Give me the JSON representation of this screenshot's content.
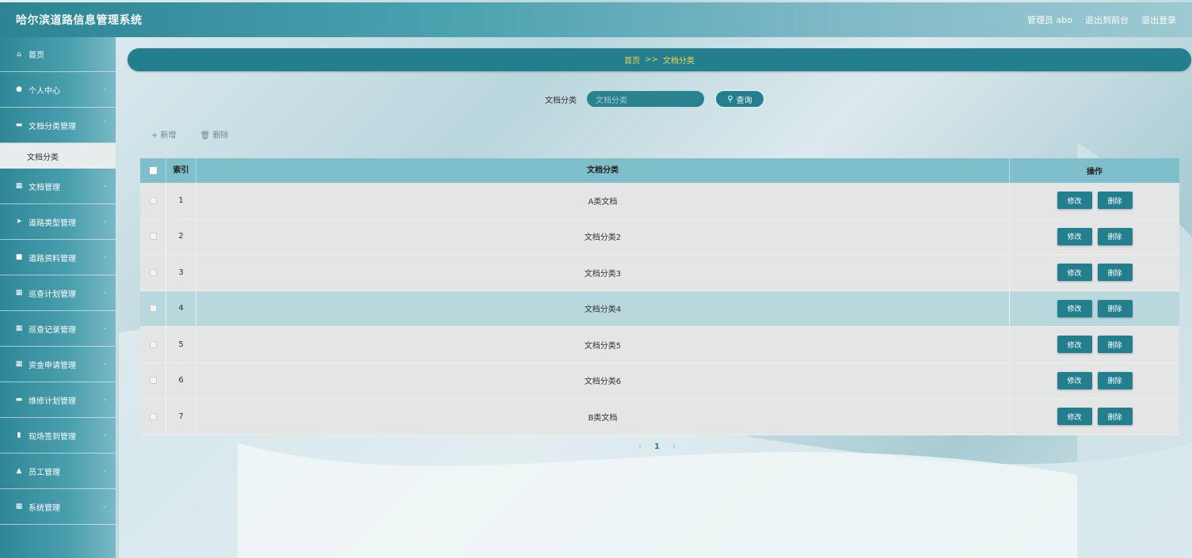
{
  "header": {
    "title": "哈尔滨道路信息管理系统",
    "user": "管理员 abo",
    "to_front": "退出到前台",
    "logout": "退出登录"
  },
  "sidebar": {
    "items": [
      {
        "label": "首页",
        "icon": "home-icon",
        "glyph": "⌂"
      },
      {
        "label": "个人中心",
        "icon": "user-icon",
        "glyph": "●"
      },
      {
        "label": "文档分类管理",
        "icon": "grid-icon",
        "glyph": "▬"
      },
      {
        "label": "文档分类",
        "icon": "",
        "glyph": ""
      },
      {
        "label": "文档管理",
        "icon": "grid-icon",
        "glyph": "▦"
      },
      {
        "label": "道路类型管理",
        "icon": "send-icon",
        "glyph": "➤"
      },
      {
        "label": "道路资料管理",
        "icon": "file-icon",
        "glyph": "■"
      },
      {
        "label": "巡查计划管理",
        "icon": "grid-icon",
        "glyph": "▦"
      },
      {
        "label": "巡查记录管理",
        "icon": "grid-icon",
        "glyph": "▦"
      },
      {
        "label": "资金申请管理",
        "icon": "grid-icon",
        "glyph": "▦"
      },
      {
        "label": "维修计划管理",
        "icon": "comment-icon",
        "glyph": "▬"
      },
      {
        "label": "现场签到管理",
        "icon": "bar-chart-icon",
        "glyph": "▮"
      },
      {
        "label": "员工管理",
        "icon": "thumbs-up-icon",
        "glyph": "▲"
      },
      {
        "label": "系统管理",
        "icon": "grid-icon",
        "glyph": "▦"
      }
    ]
  },
  "breadcrumb": {
    "home": "首页",
    "sep": ">>",
    "current": "文档分类"
  },
  "search": {
    "label": "文档分类",
    "placeholder": "文档分类",
    "button": "查询"
  },
  "toolbar": {
    "add": "+ 新增",
    "delete": "删除"
  },
  "table": {
    "columns": [
      "索引",
      "文档分类",
      "操作"
    ],
    "rows": [
      {
        "idx": "1",
        "name": "A类文档"
      },
      {
        "idx": "2",
        "name": "文档分类2"
      },
      {
        "idx": "3",
        "name": "文档分类3"
      },
      {
        "idx": "4",
        "name": "文档分类4"
      },
      {
        "idx": "5",
        "name": "文档分类5"
      },
      {
        "idx": "6",
        "name": "文档分类6"
      },
      {
        "idx": "7",
        "name": "B类文档"
      }
    ],
    "edit_label": "修改",
    "delete_label": "删除"
  },
  "pagination": {
    "prev": "‹",
    "page": "1",
    "next": "›"
  },
  "colors": {
    "primary": "#237e8d",
    "accent": "#f3d34a",
    "header_row": "#7fbecb"
  }
}
